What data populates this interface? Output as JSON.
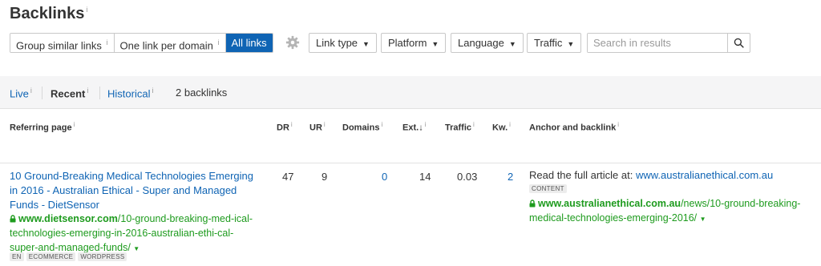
{
  "header": {
    "title": "Backlinks",
    "title_info": "i"
  },
  "toolbar": {
    "group_similar": "Group similar links",
    "one_per_domain": "One link per domain",
    "all_links": "All links",
    "info": "i",
    "link_type": "Link type",
    "platform": "Platform",
    "language": "Language",
    "traffic": "Traffic",
    "search_placeholder": "Search in results"
  },
  "tabs": {
    "live": "Live",
    "recent": "Recent",
    "historical": "Historical",
    "info": "i",
    "count": "2 backlinks"
  },
  "columns": {
    "referring_page": "Referring page",
    "dr": "DR",
    "ur": "UR",
    "domains": "Domains",
    "ext": "Ext.",
    "ext_sort": "↓",
    "traffic": "Traffic",
    "kw": "Kw.",
    "anchor": "Anchor and backlink",
    "info": "i"
  },
  "row": {
    "title": "10 Ground-Breaking Medical Technologies Emerging in 2016 - Australian Ethical - Super and Managed Funds - DietSensor",
    "url_domain": "www.dietsensor.com",
    "url_path": "/10-ground-breaking-med-ical-technologies-emerging-in-2016-australian-ethi-cal-super-and-managed-funds/",
    "tags": [
      "EN",
      "ECOMMERCE",
      "WORDPRESS"
    ],
    "dr": "47",
    "ur": "9",
    "domains": "0",
    "ext": "14",
    "traffic": "0.03",
    "kw": "2",
    "anchor_prefix": "Read the full article at: ",
    "anchor_link": "www.australianethical.com.au",
    "anchor_tag": "CONTENT",
    "backlink_domain": "www.australianethical.com.au",
    "backlink_path": "/news/10-ground-breaking-medical-technologies-emerging-2016/"
  },
  "icons": {
    "gear": "gear-icon",
    "search": "search-icon",
    "lock": "lock-icon",
    "caret": "caret-down-icon"
  },
  "colors": {
    "accent": "#0f64b4",
    "url_green": "#1e9b1e",
    "tab_bar_bg": "#f5f5f6"
  }
}
